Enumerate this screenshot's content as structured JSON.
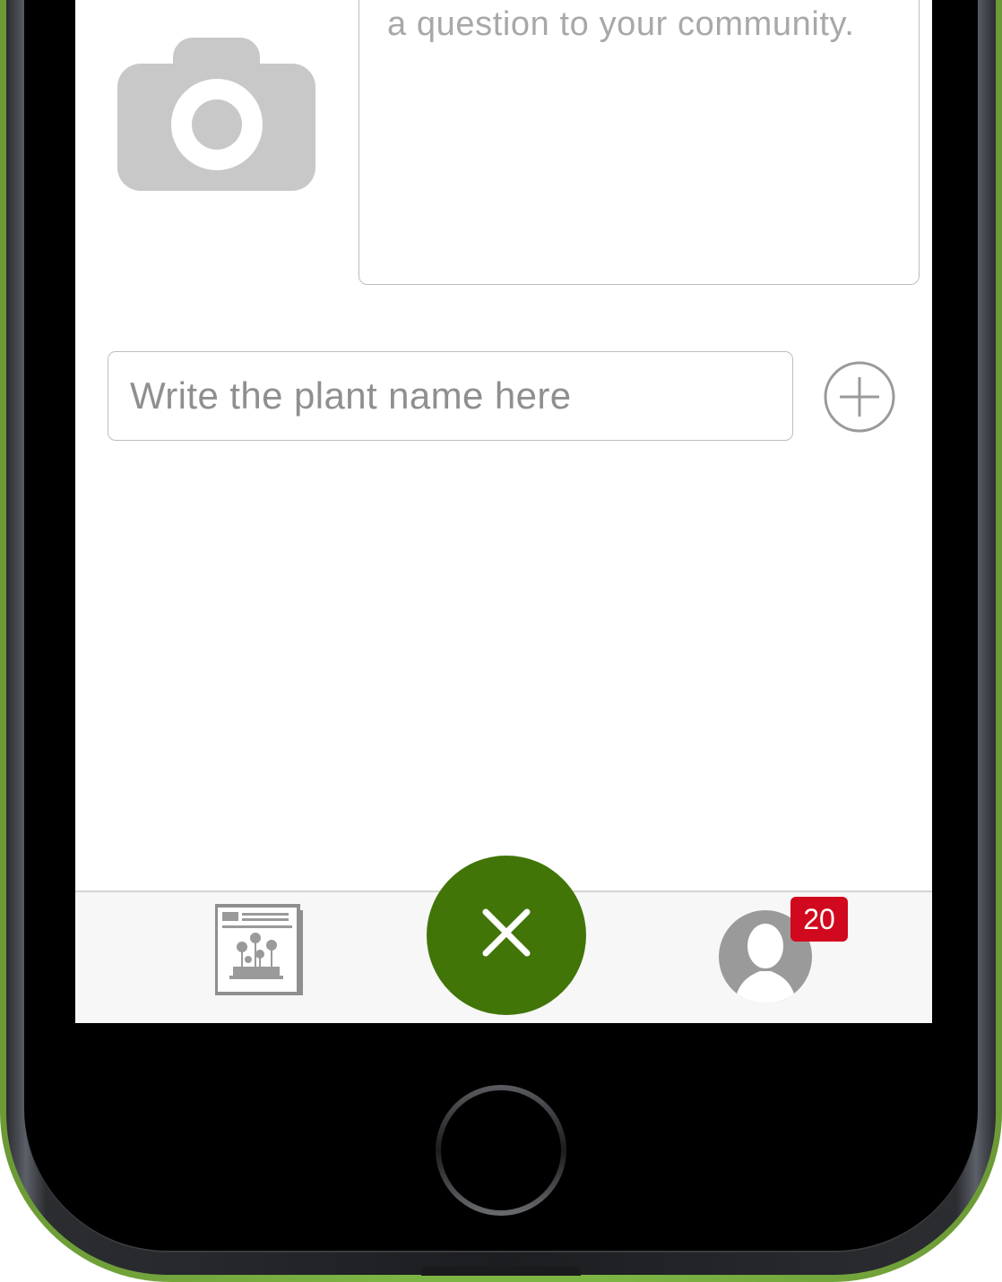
{
  "compose": {
    "question_placeholder": "a question to your community.",
    "plant_name_placeholder": "Write the plant name here",
    "camera_icon": "camera-icon",
    "add_icon": "plus-circle-icon"
  },
  "tab_bar": {
    "garden_icon": "garden-journal-icon",
    "close_icon": "close-icon",
    "profile_icon": "user-silhouette-icon",
    "notification_count": "20"
  },
  "colors": {
    "accent_green": "#417508",
    "badge_red": "#d1091e",
    "phone_shell": "#7db544",
    "placeholder_gray": "#a8a8a8",
    "icon_gray": "#c8c8c8"
  }
}
